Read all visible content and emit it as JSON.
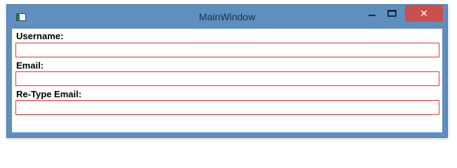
{
  "window": {
    "title": "MainWindow",
    "close_glyph": "✕",
    "accent_color": "#5f8fbf",
    "close_color": "#c9504d",
    "validation_border_color": "#d43b3b"
  },
  "form": {
    "username": {
      "label": "Username:",
      "value": ""
    },
    "email": {
      "label": "Email:",
      "value": ""
    },
    "retype_email": {
      "label": "Re-Type Email:",
      "value": ""
    }
  }
}
